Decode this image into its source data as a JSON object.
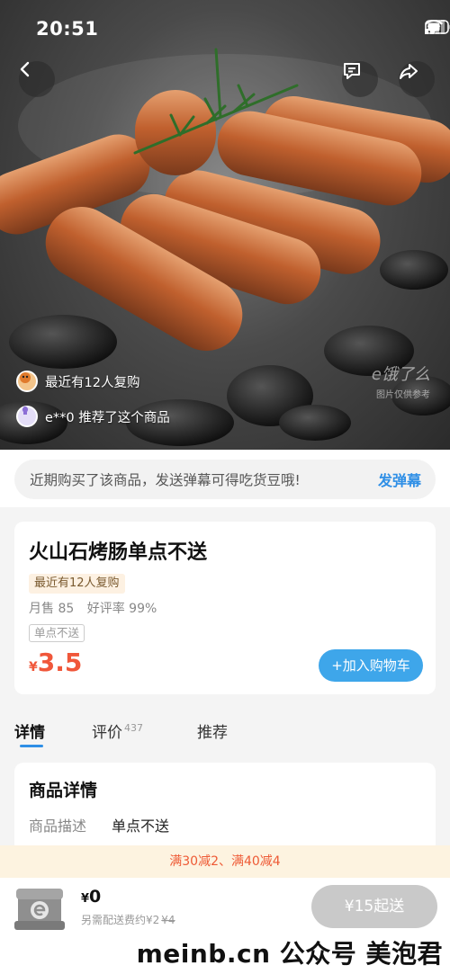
{
  "status_bar": {
    "time": "20:51"
  },
  "hero": {
    "social_proof": [
      {
        "text": "最近有12人复购",
        "avatar": "cartoon-avatar"
      },
      {
        "text": "e**0 推荐了这个商品",
        "avatar": "purple-avatar"
      }
    ],
    "watermark": "e饿了么",
    "watermark_sub": "图片仅供参考"
  },
  "danmaku": {
    "prompt": "近期购买了该商品，发送弹幕可得吃货豆哦!",
    "action": "发弹幕"
  },
  "product": {
    "title": "火山石烤肠单点不送",
    "repurchase_tag": "最近有12人复购",
    "monthly_sales": "月售 85",
    "rating": "好评率 99%",
    "single_tag": "单点不送",
    "currency": "¥",
    "price": "3.5",
    "add_to_cart": "+加入购物车"
  },
  "tabs": [
    {
      "label": "详情",
      "active": true
    },
    {
      "label": "评价",
      "count": "437"
    },
    {
      "label": "推荐"
    }
  ],
  "details": {
    "title": "商品详情",
    "rows": [
      {
        "label": "商品描述",
        "value": "单点不送"
      }
    ]
  },
  "promo": {
    "text": "满30减2、满40减4"
  },
  "bottom_bar": {
    "currency": "¥",
    "total": "0",
    "delivery_note": "另需配送费约¥2",
    "delivery_original": "¥4",
    "min_order_button": "¥15起送"
  },
  "overlay_caption": "meinb.cn 公众号 美泡君",
  "colors": {
    "accent_blue": "#2f8fe6",
    "cart_button": "#3ea6ea",
    "price_red": "#f0573a",
    "promo_bg": "#fdf3e0",
    "disabled_button": "#c9c9c9"
  },
  "icons": [
    "back-icon",
    "message-icon",
    "share-icon",
    "signal-icon",
    "wifi-icon",
    "battery-icon",
    "cart-box-icon"
  ]
}
